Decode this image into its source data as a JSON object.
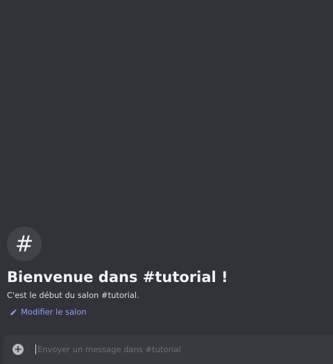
{
  "welcome": {
    "icon": "hash-icon",
    "icon_glyph": "#",
    "title": "Bienvenue dans #tutorial !",
    "description": "C'est le début du salon #tutorial.",
    "edit_label": "Modifier le salon"
  },
  "composer": {
    "add_icon": "plus-circle-icon",
    "placeholder": "Envoyer un message dans #tutorial",
    "value": ""
  },
  "colors": {
    "background": "#313338",
    "composer_bg": "#383a40",
    "link": "#949cf7",
    "title": "#f2f3f5"
  }
}
